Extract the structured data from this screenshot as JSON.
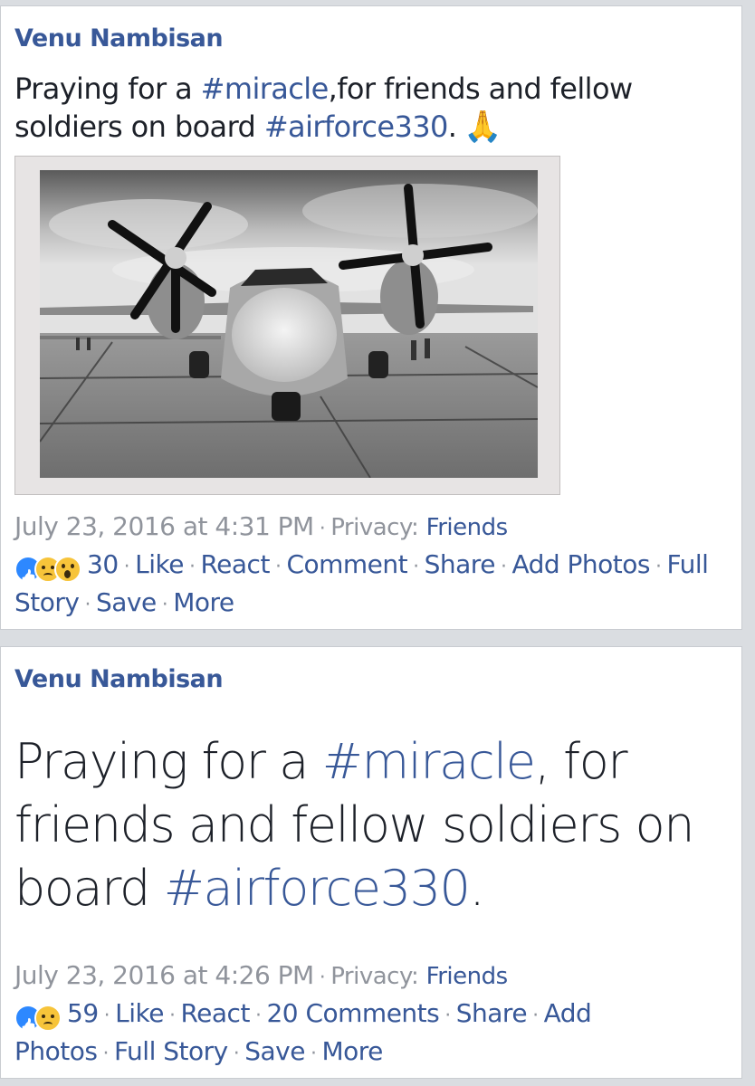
{
  "posts": [
    {
      "author": "Venu Nambisan",
      "text_before": "Praying for a ",
      "tag1": "#miracle",
      "text_middle": ",for friends and fellow soldiers on board ",
      "tag2": "#airforce330",
      "text_after": ".",
      "emoji": "🙏",
      "timestamp": "July 23, 2016 at 4:31 PM",
      "privacy_label": "Privacy:",
      "privacy_value": "Friends",
      "reactions": [
        "like-icon",
        "sad-icon",
        "wow-icon"
      ],
      "reaction_count": "30",
      "actions": {
        "like": "Like",
        "react": "React",
        "comment": "Comment",
        "share": "Share",
        "add_photos": "Add Photos",
        "full_story": "Full Story",
        "save": "Save",
        "more": "More"
      }
    },
    {
      "author": "Venu Nambisan",
      "text_before": "Praying for a ",
      "tag1": "#miracle",
      "text_middle": ", for friends and fellow soldiers on board ",
      "tag2": "#airforce330",
      "text_after": ".",
      "timestamp": "July 23, 2016 at 4:26 PM",
      "privacy_label": "Privacy:",
      "privacy_value": "Friends",
      "reactions": [
        "like-icon",
        "sad-icon"
      ],
      "reaction_count": "59",
      "actions": {
        "like": "Like",
        "react": "React",
        "comment": "20 Comments",
        "share": "Share",
        "add_photos": "Add Photos",
        "full_story": "Full Story",
        "save": "Save",
        "more": "More"
      }
    }
  ],
  "colors": {
    "link": "#385898",
    "meta": "#90949c",
    "text": "#1d2129",
    "background": "#dadde1"
  }
}
